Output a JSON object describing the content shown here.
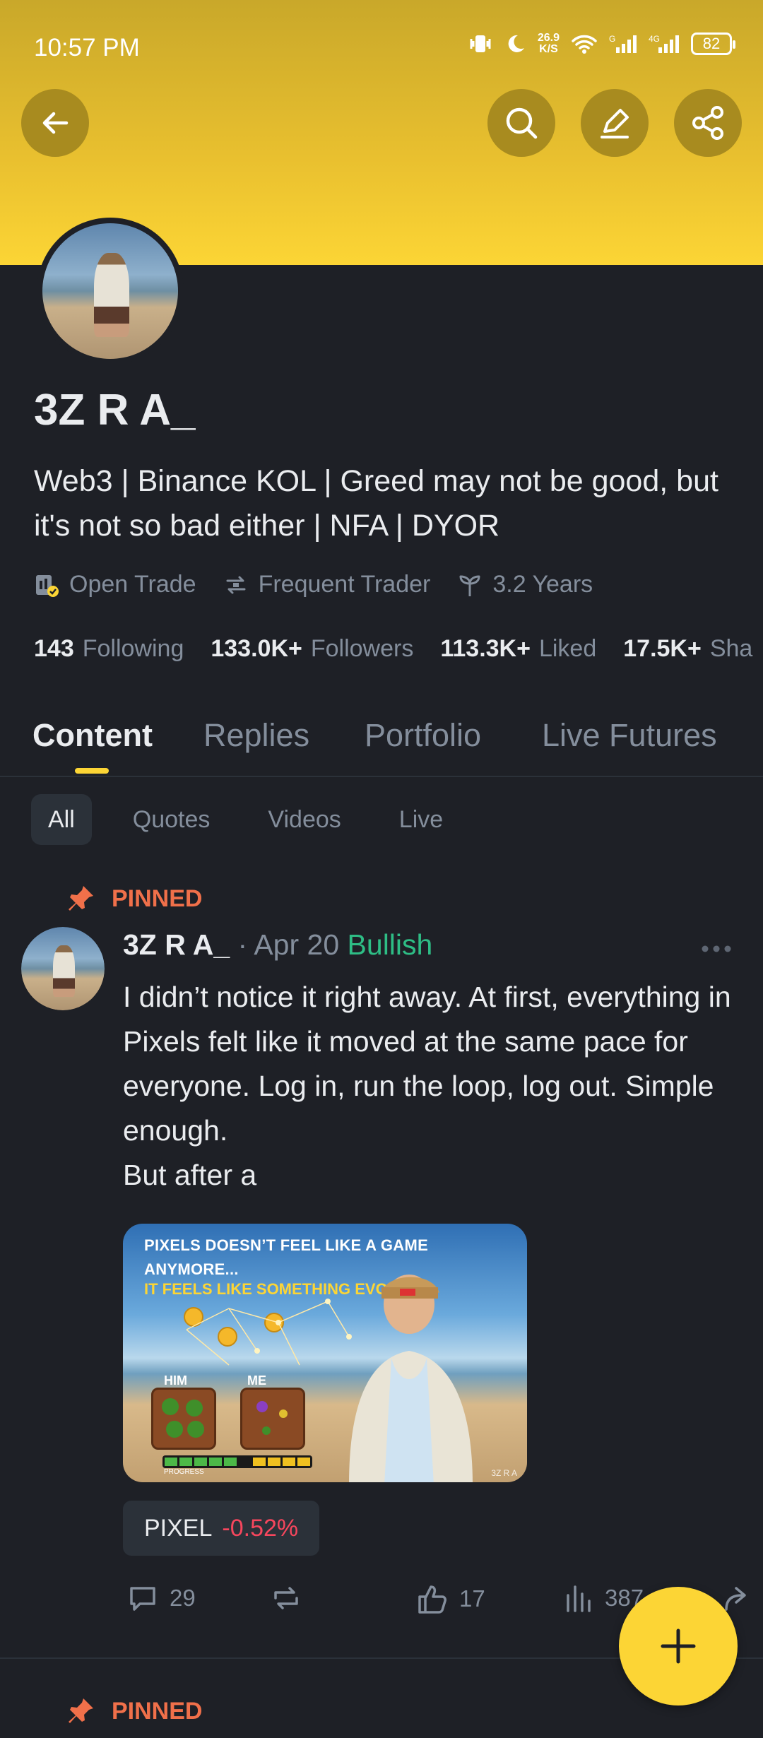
{
  "status_bar": {
    "time": "10:57 PM",
    "net_speed_value": "26.9",
    "net_speed_unit": "K/S",
    "sim1_label": "G",
    "sim2_label": "4G",
    "battery": "82"
  },
  "profile": {
    "name": "3Z R A_",
    "bio": "Web3 | Binance KOL | Greed may not be good, but it's not so bad either | NFA | DYOR",
    "badges": [
      {
        "label": "Open Trade",
        "icon": "open-trade-icon"
      },
      {
        "label": "Frequent Trader",
        "icon": "frequent-trader-icon"
      },
      {
        "label": "3.2 Years",
        "icon": "sprout-icon"
      }
    ],
    "stats": [
      {
        "value": "143",
        "label": "Following"
      },
      {
        "value": "133.0K+",
        "label": "Followers"
      },
      {
        "value": "113.3K+",
        "label": "Liked"
      },
      {
        "value": "17.5K+",
        "label": "Sha"
      }
    ]
  },
  "tabs": [
    "Content",
    "Replies",
    "Portfolio",
    "Live Futures"
  ],
  "filters": [
    "All",
    "Quotes",
    "Videos",
    "Live"
  ],
  "post": {
    "pinned_label": "PINNED",
    "author": "3Z R A_",
    "date": "· Apr 20",
    "sentiment": "Bullish",
    "text": "I didn’t notice it right away. At first, everything in Pixels felt like it moved at the same pace for everyone. Log in, run the loop, log out. Simple enough.\nBut after a",
    "image": {
      "title_line1": "PIXELS DOESN’T FEEL LIKE A GAME",
      "title_line2": "ANYMORE...",
      "subtitle": "IT FEELS LIKE SOMETHING EVOLVING",
      "label_him": "HIM",
      "label_me": "ME",
      "progress_label": "PROGRESS",
      "watermark": "3Z R A"
    },
    "ticker": {
      "symbol": "PIXEL",
      "change": "-0.52%"
    },
    "comments": "29",
    "likes": "17",
    "views": "387"
  },
  "next_post": {
    "pinned_label": "PINNED"
  },
  "colors": {
    "accent": "#fcd535",
    "background": "#1e2026",
    "bullish": "#2ebd85",
    "bearish": "#f6465d",
    "pinned": "#f0704a"
  }
}
